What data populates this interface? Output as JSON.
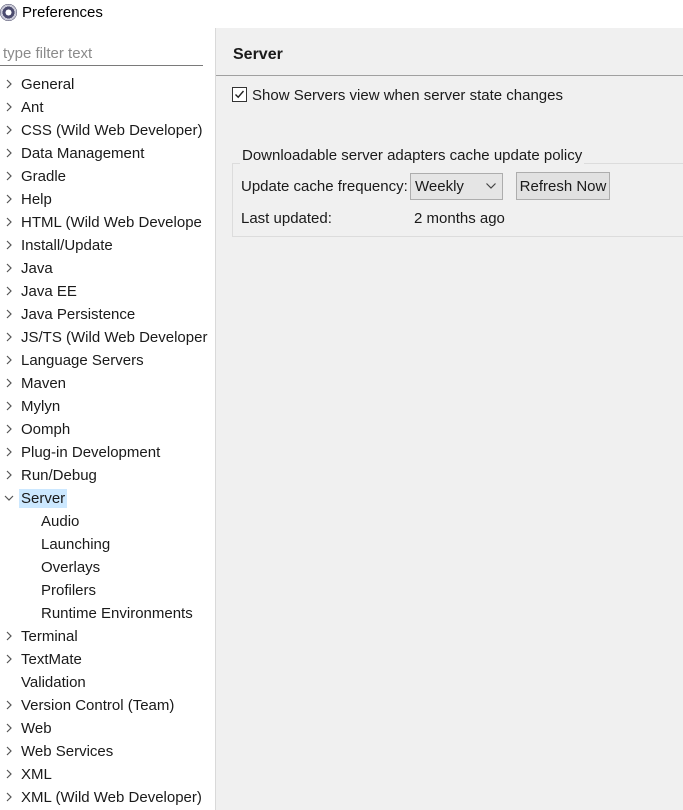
{
  "window": {
    "title": "Preferences",
    "icon": "eclipse-icon"
  },
  "filter": {
    "placeholder": "type filter text",
    "value": ""
  },
  "tree": [
    {
      "label": "General",
      "level": 0,
      "expander": "collapsed"
    },
    {
      "label": "Ant",
      "level": 0,
      "expander": "collapsed"
    },
    {
      "label": "CSS (Wild Web Developer)",
      "level": 0,
      "expander": "collapsed"
    },
    {
      "label": "Data Management",
      "level": 0,
      "expander": "collapsed"
    },
    {
      "label": "Gradle",
      "level": 0,
      "expander": "collapsed"
    },
    {
      "label": "Help",
      "level": 0,
      "expander": "collapsed"
    },
    {
      "label": "HTML (Wild Web Develope",
      "level": 0,
      "expander": "collapsed"
    },
    {
      "label": "Install/Update",
      "level": 0,
      "expander": "collapsed"
    },
    {
      "label": "Java",
      "level": 0,
      "expander": "collapsed"
    },
    {
      "label": "Java EE",
      "level": 0,
      "expander": "collapsed"
    },
    {
      "label": "Java Persistence",
      "level": 0,
      "expander": "collapsed"
    },
    {
      "label": "JS/TS (Wild Web Developer",
      "level": 0,
      "expander": "collapsed"
    },
    {
      "label": "Language Servers",
      "level": 0,
      "expander": "collapsed"
    },
    {
      "label": "Maven",
      "level": 0,
      "expander": "collapsed"
    },
    {
      "label": "Mylyn",
      "level": 0,
      "expander": "collapsed"
    },
    {
      "label": "Oomph",
      "level": 0,
      "expander": "collapsed"
    },
    {
      "label": "Plug-in Development",
      "level": 0,
      "expander": "collapsed"
    },
    {
      "label": "Run/Debug",
      "level": 0,
      "expander": "collapsed"
    },
    {
      "label": "Server",
      "level": 0,
      "expander": "expanded",
      "selected": true
    },
    {
      "label": "Audio",
      "level": 1,
      "expander": "none"
    },
    {
      "label": "Launching",
      "level": 1,
      "expander": "none"
    },
    {
      "label": "Overlays",
      "level": 1,
      "expander": "none"
    },
    {
      "label": "Profilers",
      "level": 1,
      "expander": "none"
    },
    {
      "label": "Runtime Environments",
      "level": 1,
      "expander": "none"
    },
    {
      "label": "Terminal",
      "level": 0,
      "expander": "collapsed"
    },
    {
      "label": "TextMate",
      "level": 0,
      "expander": "collapsed"
    },
    {
      "label": "Validation",
      "level": 0,
      "expander": "none"
    },
    {
      "label": "Version Control (Team)",
      "level": 0,
      "expander": "collapsed"
    },
    {
      "label": "Web",
      "level": 0,
      "expander": "collapsed"
    },
    {
      "label": "Web Services",
      "level": 0,
      "expander": "collapsed"
    },
    {
      "label": "XML",
      "level": 0,
      "expander": "collapsed"
    },
    {
      "label": "XML (Wild Web Developer)",
      "level": 0,
      "expander": "collapsed"
    }
  ],
  "page": {
    "title": "Server",
    "show_servers_view": {
      "label": "Show Servers view when server state changes",
      "checked": true
    },
    "cache_group": {
      "title": "Downloadable server adapters cache update policy",
      "frequency_label": "Update cache frequency:",
      "frequency_value": "Weekly",
      "refresh_label": "Refresh Now",
      "last_updated_label": "Last updated:",
      "last_updated_value": "2 months ago"
    }
  },
  "colors": {
    "selection": "#cce8ff",
    "right_bg": "#f0f0f0",
    "text": "#1a1a1a"
  }
}
